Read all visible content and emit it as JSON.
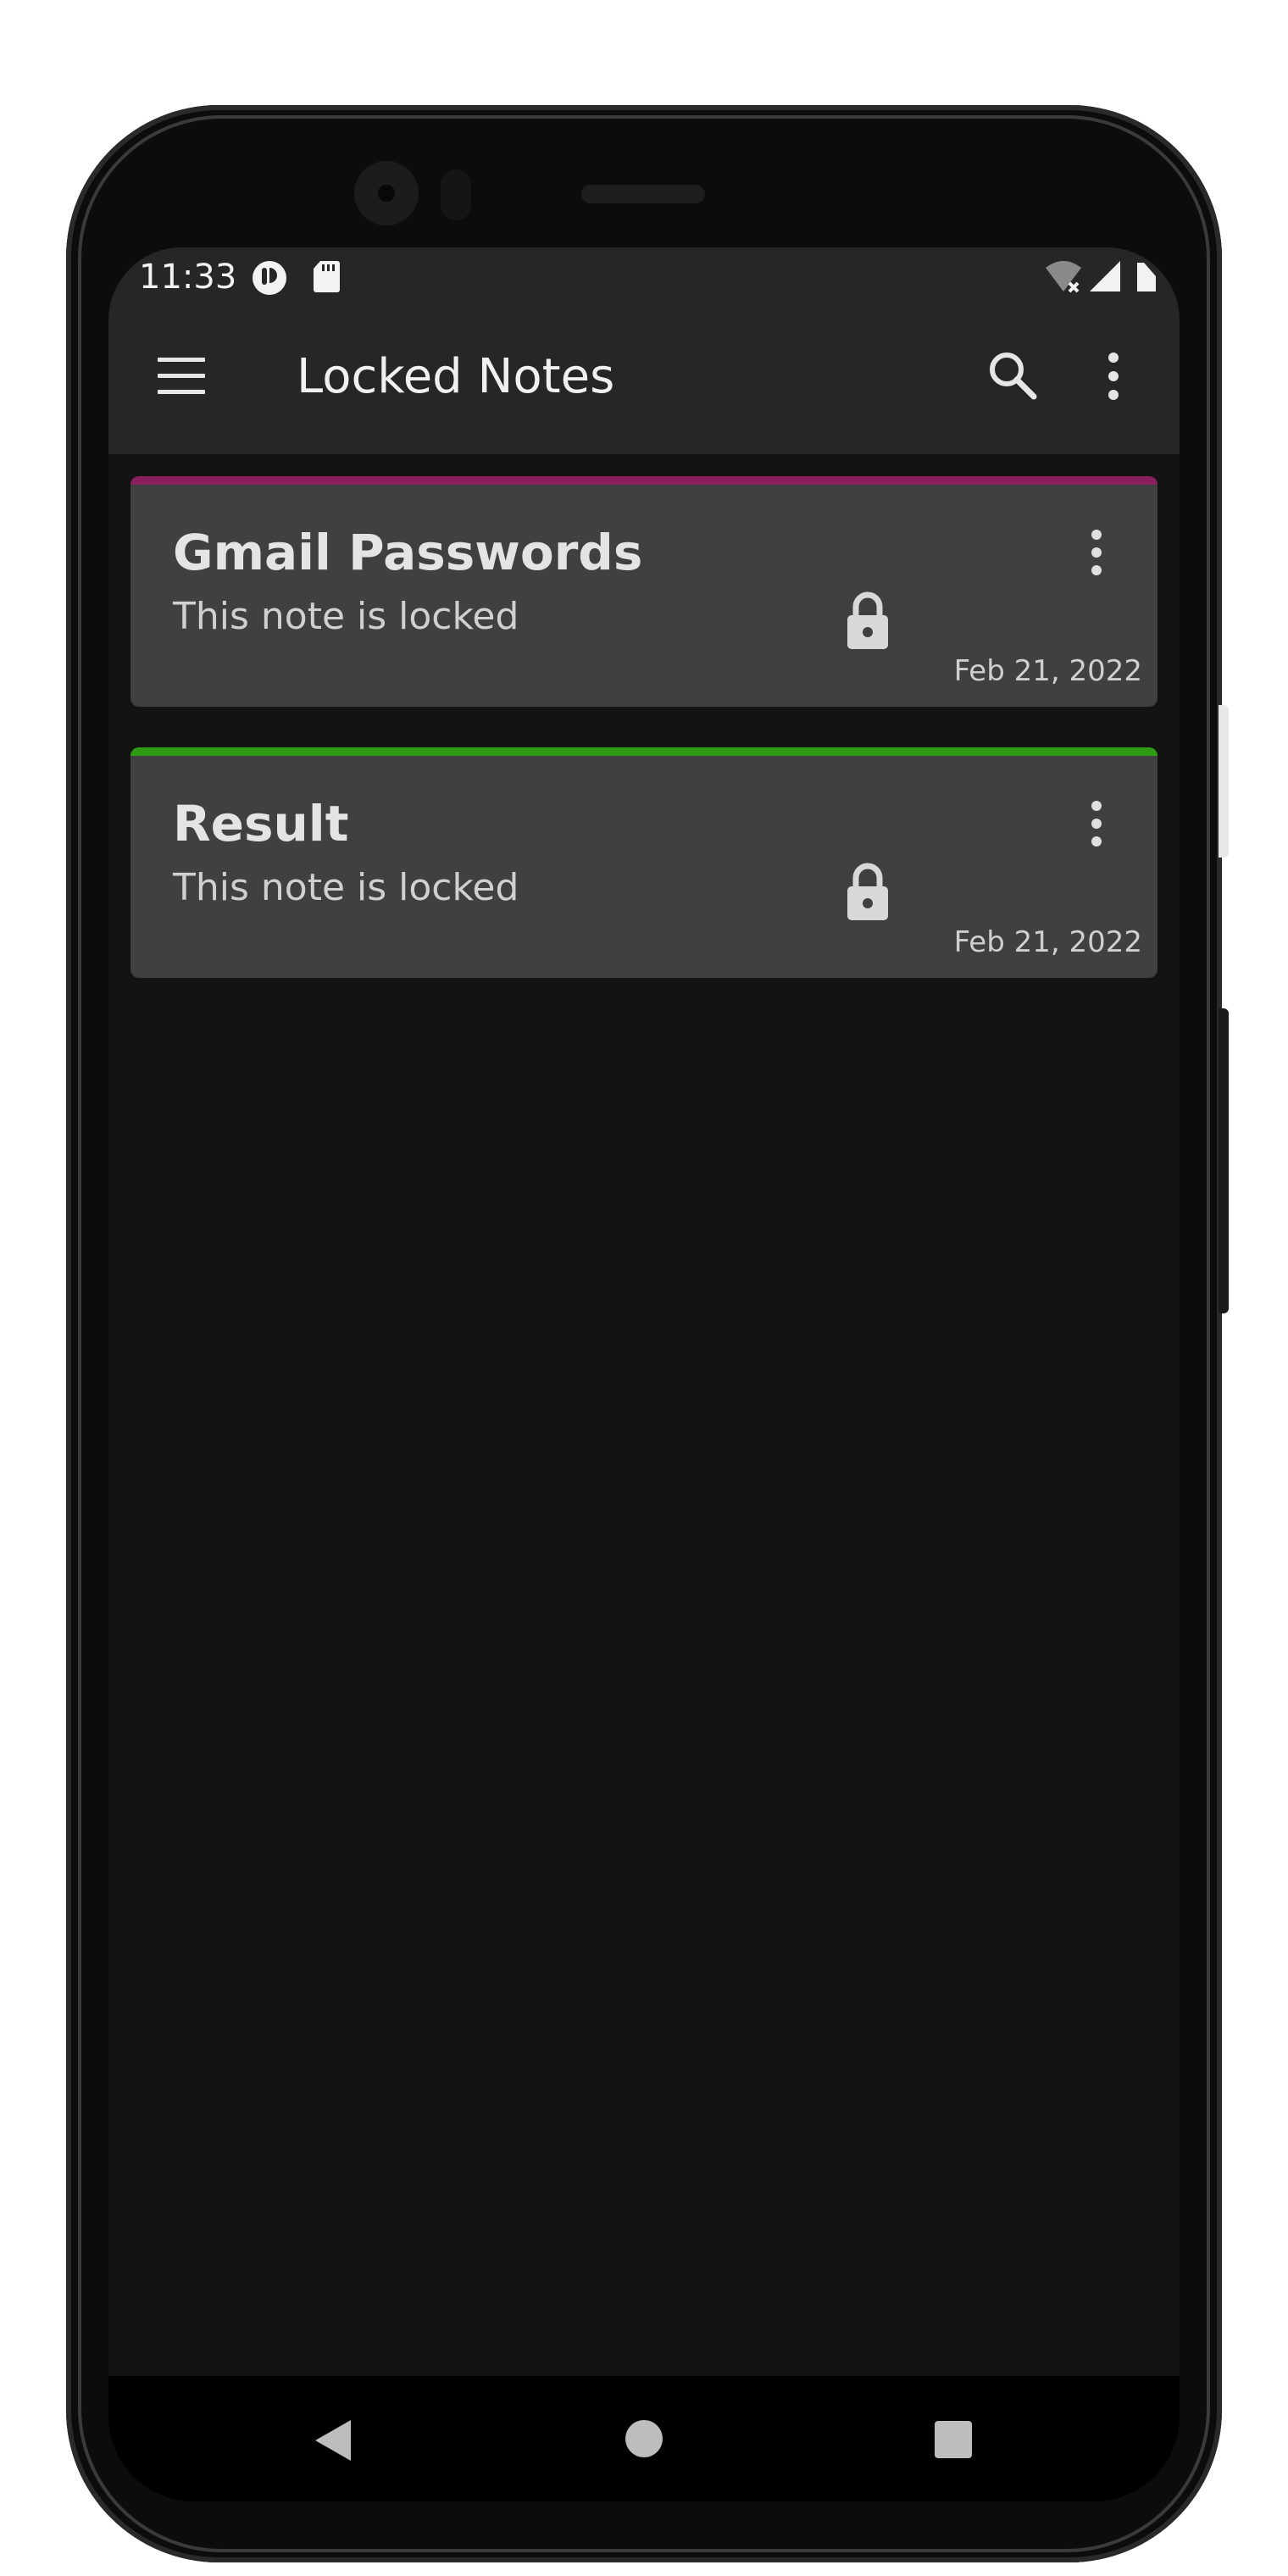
{
  "status_bar": {
    "time": "11:33",
    "notification_icons": [
      "app-notification-icon",
      "sd-card-icon"
    ],
    "system_icons": [
      "wifi-off-icon",
      "cell-signal-icon",
      "battery-icon"
    ]
  },
  "app_bar": {
    "title": "Locked Notes",
    "actions": [
      "menu-icon",
      "search-icon",
      "overflow-menu-icon"
    ]
  },
  "notes": [
    {
      "title": "Gmail Passwords",
      "preview": "This note is locked",
      "date": "Feb 21, 2022",
      "accent_color": "#8a1f5c"
    },
    {
      "title": "Result",
      "preview": "This note is locked",
      "date": "Feb 21, 2022",
      "accent_color": "#2e9a12"
    }
  ],
  "nav_bar": {
    "buttons": [
      "back-icon",
      "home-icon",
      "recents-icon"
    ]
  },
  "colors": {
    "background": "#131313",
    "app_bar": "#262626",
    "card": "#404040",
    "text_primary": "#e4e4e4"
  }
}
